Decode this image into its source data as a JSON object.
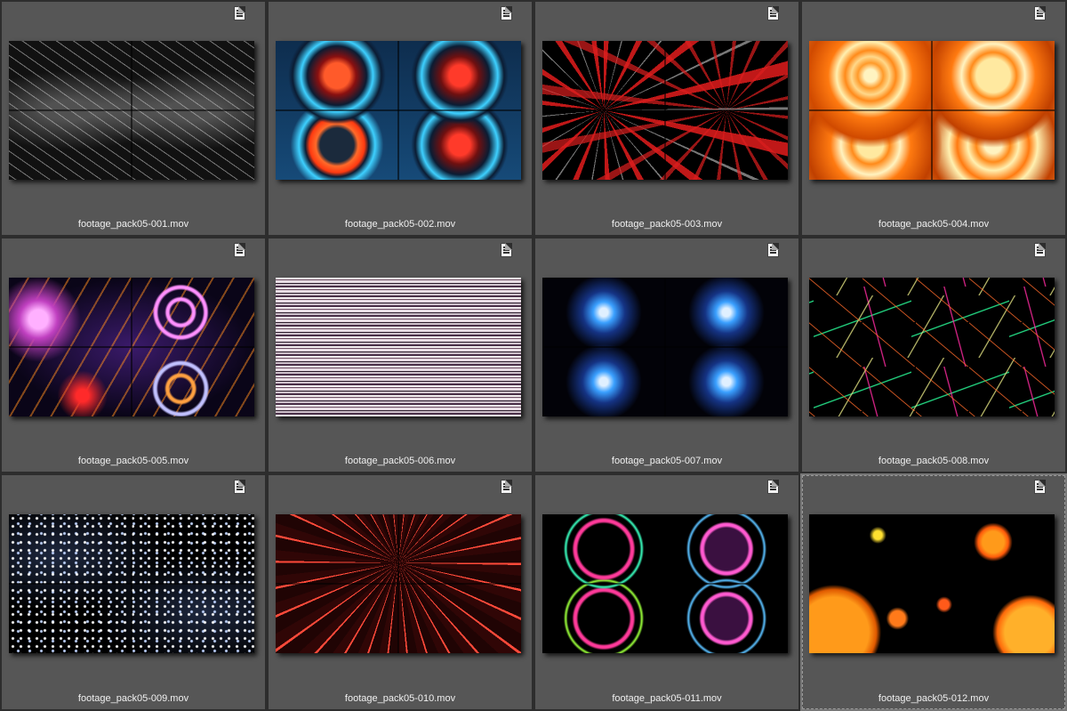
{
  "items": [
    {
      "filename": "footage_pack05-001.mov",
      "icon": "video-file-icon"
    },
    {
      "filename": "footage_pack05-002.mov",
      "icon": "video-file-icon"
    },
    {
      "filename": "footage_pack05-003.mov",
      "icon": "video-file-icon"
    },
    {
      "filename": "footage_pack05-004.mov",
      "icon": "video-file-icon"
    },
    {
      "filename": "footage_pack05-005.mov",
      "icon": "video-file-icon"
    },
    {
      "filename": "footage_pack05-006.mov",
      "icon": "video-file-icon"
    },
    {
      "filename": "footage_pack05-007.mov",
      "icon": "video-file-icon"
    },
    {
      "filename": "footage_pack05-008.mov",
      "icon": "video-file-icon"
    },
    {
      "filename": "footage_pack05-009.mov",
      "icon": "video-file-icon"
    },
    {
      "filename": "footage_pack05-010.mov",
      "icon": "video-file-icon"
    },
    {
      "filename": "footage_pack05-011.mov",
      "icon": "video-file-icon"
    },
    {
      "filename": "footage_pack05-012.mov",
      "icon": "video-file-icon"
    }
  ],
  "selected_index": 11,
  "colors": {
    "tile_background": "#565656",
    "tile_border": "#2d2d2d",
    "caption_text": "#f0f0f0"
  }
}
